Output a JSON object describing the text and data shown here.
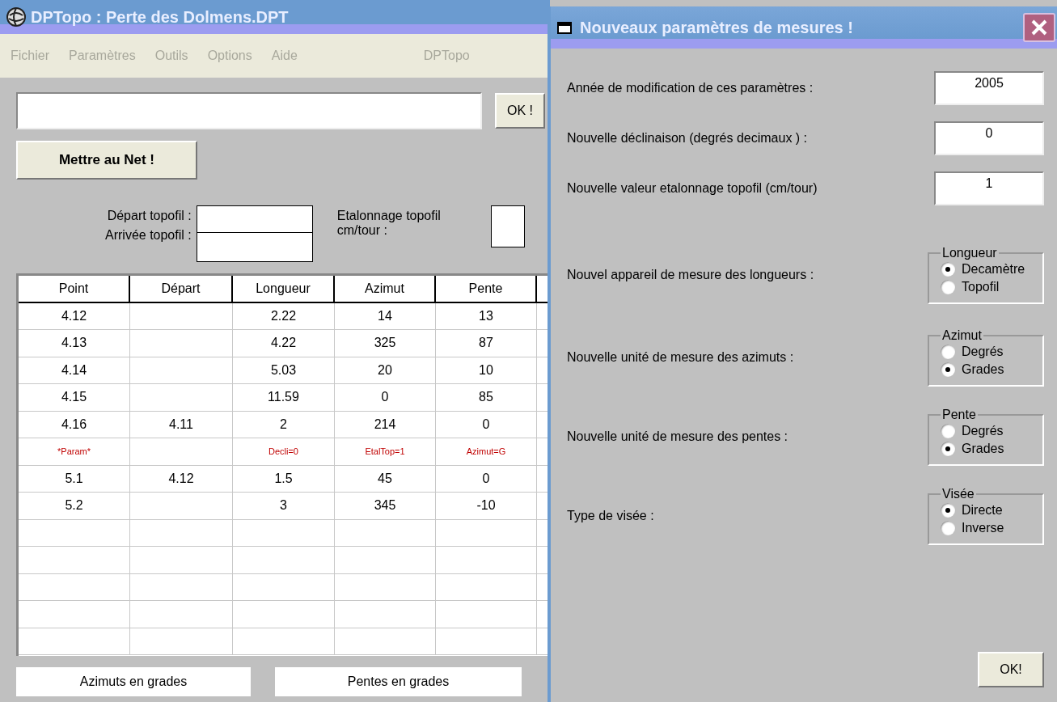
{
  "main_window": {
    "title": "DPTopo : Perte des Dolmens.DPT",
    "menu": [
      {
        "label": "Fichier"
      },
      {
        "label": "Paramètres"
      },
      {
        "label": "Outils"
      },
      {
        "label": "Options"
      },
      {
        "label": "Aide"
      },
      {
        "label": "DPTopo"
      }
    ],
    "ok_button": "OK !",
    "publish_button": "Mettre au Net !",
    "topofil": {
      "start_label": "Départ  topofil :",
      "end_label": "Arrivée topofil :",
      "calibration_label": "Etalonnage topofil cm/tour :"
    },
    "table": {
      "columns": [
        "Point",
        "Départ",
        "Longueur",
        "Azimut",
        "Pente"
      ],
      "rows": [
        {
          "kind": "data",
          "cells": [
            "4.12",
            null,
            "2.22",
            "14",
            "13"
          ]
        },
        {
          "kind": "data",
          "cells": [
            "4.13",
            null,
            "4.22",
            "325",
            "87"
          ]
        },
        {
          "kind": "data",
          "cells": [
            "4.14",
            null,
            "5.03",
            "20",
            "10"
          ]
        },
        {
          "kind": "data",
          "cells": [
            "4.15",
            null,
            "11.59",
            "0",
            "85"
          ]
        },
        {
          "kind": "data",
          "cells": [
            "4.16",
            "4.11",
            "2",
            "214",
            "0"
          ]
        },
        {
          "kind": "param",
          "cells": [
            "*Param*",
            null,
            "Decli=0",
            "EtalTop=1",
            "Azimut=G"
          ]
        },
        {
          "kind": "data",
          "cells": [
            "5.1",
            "4.12",
            "1.5",
            "45",
            "0"
          ]
        },
        {
          "kind": "data",
          "cells": [
            "5.2",
            null,
            "3",
            "345",
            "-10"
          ]
        }
      ]
    },
    "status": [
      "Azimuts en grades",
      "Pentes en grades"
    ]
  },
  "dialog": {
    "title": "Nouveaux paramètres de mesures !",
    "fields": [
      {
        "label": "Année de modification de ces paramètres :",
        "value": "2005"
      },
      {
        "label": "Nouvelle déclinaison (degrés decimaux ) :",
        "value": "0"
      },
      {
        "label": "Nouvelle valeur etalonnage topofil (cm/tour)",
        "value": "1"
      }
    ],
    "groups": [
      {
        "label": "Nouvel appareil de mesure des longueurs :",
        "legend": "Longueur",
        "options": [
          {
            "label": "Decamètre",
            "selected": true
          },
          {
            "label": "Topofil",
            "selected": false
          }
        ]
      },
      {
        "label": "Nouvelle unité de mesure des azimuts :",
        "legend": "Azimut",
        "options": [
          {
            "label": "Degrés",
            "selected": false
          },
          {
            "label": "Grades",
            "selected": true
          }
        ]
      },
      {
        "label": "Nouvelle unité de mesure des pentes :",
        "legend": "Pente",
        "options": [
          {
            "label": "Degrés",
            "selected": false
          },
          {
            "label": "Grades",
            "selected": true
          }
        ]
      },
      {
        "label": "Type de visée :",
        "legend": "Visée",
        "options": [
          {
            "label": "Directe",
            "selected": true
          },
          {
            "label": "Inverse",
            "selected": false
          }
        ]
      }
    ],
    "ok_button": "OK!"
  }
}
